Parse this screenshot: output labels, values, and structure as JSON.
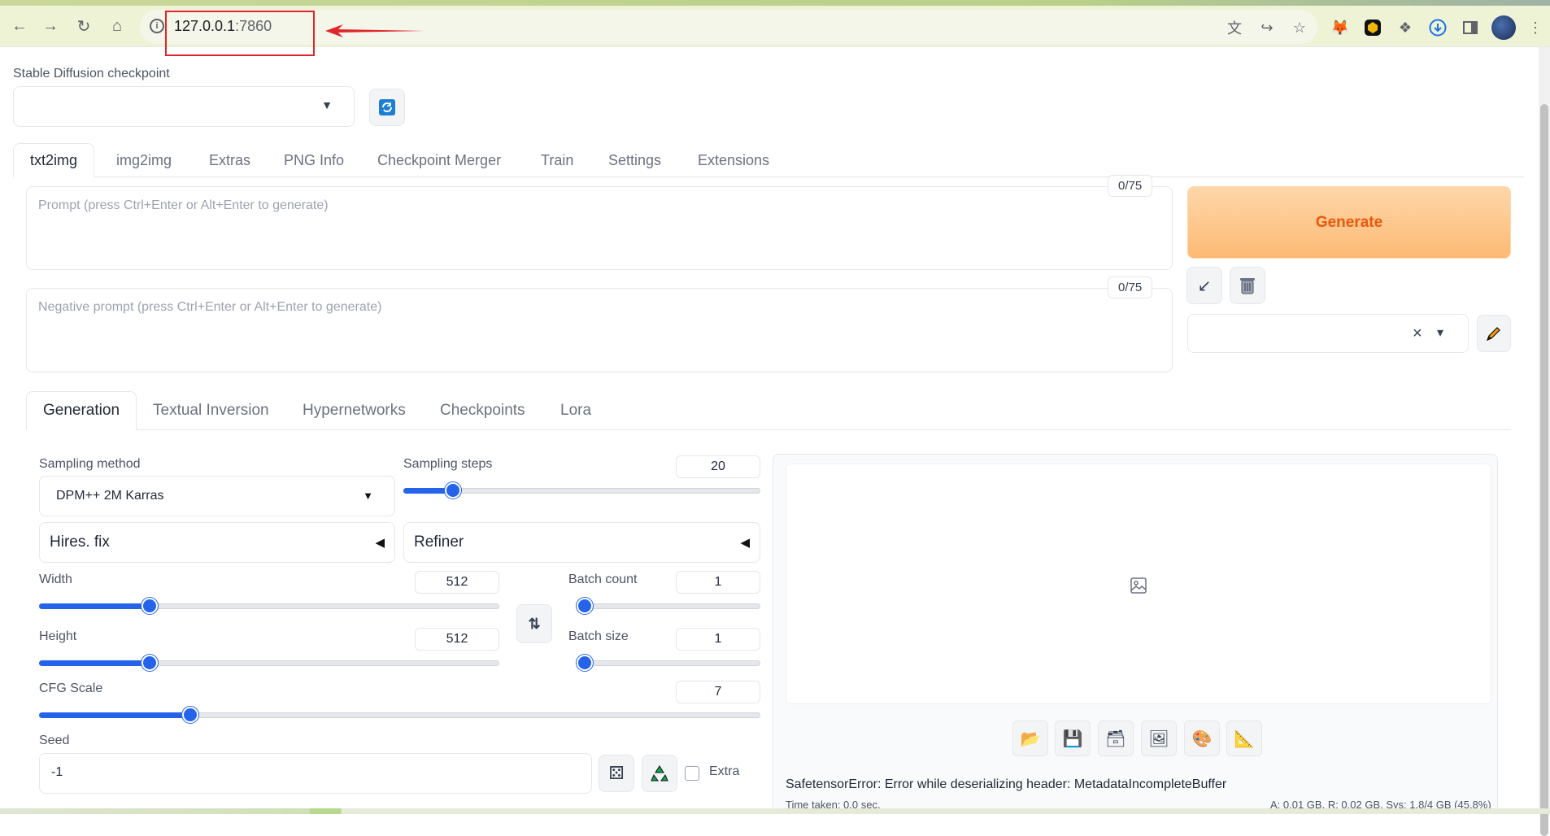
{
  "browser": {
    "url_host": "127.0.0.1",
    "url_port": ":7860"
  },
  "checkpoint": {
    "label": "Stable Diffusion checkpoint",
    "value": ""
  },
  "main_tabs": [
    {
      "label": "txt2img",
      "active": true
    },
    {
      "label": "img2img"
    },
    {
      "label": "Extras"
    },
    {
      "label": "PNG Info"
    },
    {
      "label": "Checkpoint Merger"
    },
    {
      "label": "Train"
    },
    {
      "label": "Settings"
    },
    {
      "label": "Extensions"
    }
  ],
  "prompt": {
    "placeholder": "Prompt (press Ctrl+Enter or Alt+Enter to generate)",
    "token_count": "0/75"
  },
  "negative_prompt": {
    "placeholder": "Negative prompt (press Ctrl+Enter or Alt+Enter to generate)",
    "token_count": "0/75"
  },
  "generate_label": "Generate",
  "styles": {
    "clear_symbol": "×",
    "caret": "▾"
  },
  "sub_tabs": [
    {
      "label": "Generation",
      "active": true
    },
    {
      "label": "Textual Inversion"
    },
    {
      "label": "Hypernetworks"
    },
    {
      "label": "Checkpoints"
    },
    {
      "label": "Lora"
    }
  ],
  "sampling": {
    "method_label": "Sampling method",
    "method_value": "DPM++ 2M Karras",
    "steps_label": "Sampling steps",
    "steps_value": "20",
    "steps_fraction": 0.14
  },
  "accordions": {
    "hires_fix": "Hires. fix",
    "refiner": "Refiner",
    "arrow": "◀"
  },
  "width": {
    "label": "Width",
    "value": "512",
    "fraction": 0.24
  },
  "height": {
    "label": "Height",
    "value": "512",
    "fraction": 0.24
  },
  "batch_count": {
    "label": "Batch count",
    "value": "1",
    "fraction": 0.0
  },
  "batch_size": {
    "label": "Batch size",
    "value": "1",
    "fraction": 0.0
  },
  "cfg_scale": {
    "label": "CFG Scale",
    "value": "7",
    "fraction": 0.21
  },
  "seed": {
    "label": "Seed",
    "value": "-1",
    "extra_label": "Extra"
  },
  "output": {
    "error": "SafetensorError: Error while deserializing header: MetadataIncompleteBuffer",
    "time": "Time taken: 0.0 sec.",
    "memory": "A: 0.01 GB, R: 0.02 GB, Sys: 1.8/4 GB (45.8%)"
  }
}
